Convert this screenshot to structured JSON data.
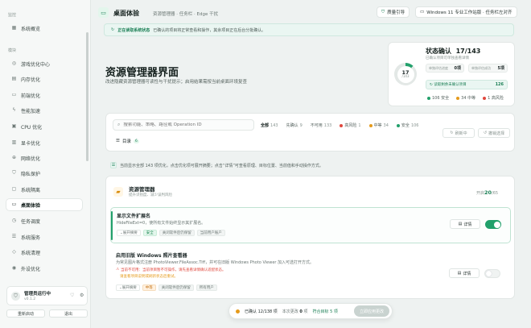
{
  "sidebar": {
    "sections": [
      {
        "title": "监控",
        "items": [
          {
            "label": "系统概览",
            "icon": "grid-icon"
          }
        ]
      },
      {
        "title": "模块",
        "items": [
          {
            "label": "游戏优化中心",
            "icon": "gamepad-icon"
          },
          {
            "label": "内存优化",
            "icon": "memory-icon"
          },
          {
            "label": "前端优化",
            "icon": "monitor-icon"
          },
          {
            "label": "性能加速",
            "icon": "bolt-icon"
          },
          {
            "label": "CPU 优化",
            "icon": "cpu-icon"
          },
          {
            "label": "显卡优化",
            "icon": "gpu-icon"
          },
          {
            "label": "网络优化",
            "icon": "network-icon"
          },
          {
            "label": "隐私保护",
            "icon": "shield-icon"
          },
          {
            "label": "系统隔离",
            "icon": "lock-icon"
          },
          {
            "label": "桌面体验",
            "icon": "desktop-icon"
          },
          {
            "label": "任务调度",
            "icon": "schedule-icon"
          },
          {
            "label": "系统服务",
            "icon": "services-icon"
          },
          {
            "label": "系统清理",
            "icon": "broom-icon"
          },
          {
            "label": "外设优化",
            "icon": "mouse-icon"
          }
        ]
      }
    ],
    "active": "桌面体验",
    "user": {
      "name": "管理员运行中",
      "version": "v0.1.2"
    },
    "reboot_label": "重新启动",
    "exit_label": "退出"
  },
  "topbar": {
    "title": "桌面体验",
    "breadcrumb": "资源管理器 · 任务栏 · Edge 干扰",
    "btn_guide": "质量引导",
    "btn_system": "Windows 11 专业工作站版 · 任务栏左对齐"
  },
  "notice": {
    "bold": "正在读取系统状态",
    "text": "已确认的项目将正常查看和操作，其余项目正在后台分批确认。"
  },
  "hero": {
    "title": "资源管理器界面",
    "subtitle": "改进隐藏资源管理器可读性与干扰提示；启用结果需按当前桌面环境复查"
  },
  "status": {
    "title": "状态确认",
    "count": "17/143",
    "desc": "已确认项目可单独查看详情",
    "ring_main": "17",
    "ring_sub": "/143",
    "cells": [
      {
        "label": "单独评估进度",
        "value": "0项"
      },
      {
        "label": "单独评估成功",
        "value": "5项"
      }
    ],
    "reading_label": "读取剩余未确认项目",
    "reading_value": "126",
    "legend": [
      {
        "label": "106 安全",
        "color": "#22a06b"
      },
      {
        "label": "34 中等",
        "color": "#e59a1b"
      },
      {
        "label": "1 高风险",
        "color": "#e0483e"
      }
    ]
  },
  "filter": {
    "search_placeholder": "搜索功能、策略、路径或 Operation ID",
    "chips": [
      {
        "label": "全部",
        "count": "143",
        "active": true
      },
      {
        "label": "先确认",
        "count": "9"
      },
      {
        "label": "不可用",
        "count": "133"
      },
      {
        "label": "高风险",
        "count": "1",
        "dot": "#e0483e"
      },
      {
        "label": "中等",
        "count": "34",
        "dot": "#e59a1b"
      },
      {
        "label": "安全",
        "count": "106",
        "dot": "#22a06b"
      }
    ],
    "refresh_label": "刷新中",
    "undo_label": "撤销选择",
    "toc_label": "目录",
    "toc_count": "6"
  },
  "info_line": "当前显示全部 143 项优化，点击优化项可展开摘要；点击“详情”可查看原理、目标位置、当前值和手动操作方式。",
  "group": {
    "title": "资源管理器",
    "subtitle": "提升识别度、减少误判风险",
    "enabled_prefix": "开启",
    "enabled": "20",
    "total": "/65"
  },
  "items": [
    {
      "title": "显示文件扩展名",
      "desc": "HideFileExt=0，使所有文件始终显示其扩展名。",
      "expand": "展开摘要",
      "tags": [
        "安全",
        "关闭软件后仍保留",
        "当前用户账户"
      ],
      "detail_label": "详情",
      "enabled": true
    },
    {
      "title": "启用旧版 Windows 照片查看器",
      "desc": "为常见图片格式注册 PhotoViewer.FileAssoc.Tiff，并可在旧版 Windows Photo Viewer 加入可选打开方式。",
      "warn1": "当前不可用：当前项目暂不可操作，请先查看详情确认适配状态。",
      "warn2": "请查看项目说明或刷新状态后重试。",
      "expand": "展开摘要",
      "tags": [
        "中等",
        "关闭软件后仍保留",
        "所有用户"
      ],
      "detail_label": "详情",
      "enabled": false
    }
  ],
  "bottom_bar": {
    "confirmed": "已确认 12/138 项",
    "changed_prefix": "本次更改",
    "changed": "0",
    "changed_suffix": "项",
    "target": "符合目标 5 项",
    "apply": "立即应用更改"
  },
  "colors": {
    "accent": "#22a06b",
    "accent_dark": "#1b7f55",
    "warn": "#e0483e",
    "orange": "#e59a1b"
  }
}
